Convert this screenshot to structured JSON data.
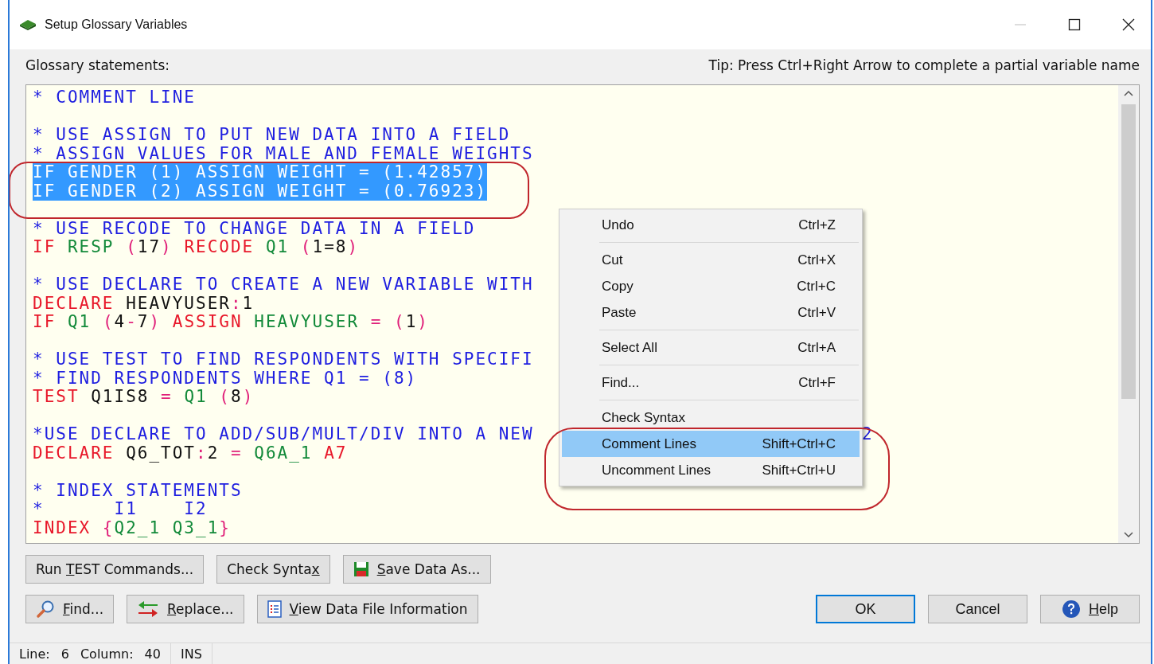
{
  "window": {
    "title": "Setup Glossary Variables"
  },
  "editor_label": "Glossary statements:",
  "tip": "Tip: Press Ctrl+Right Arrow to complete a partial variable name",
  "editor": {
    "lines": [
      {
        "selected": false,
        "tokens": [
          {
            "kind": "comment",
            "text": "* COMMENT LINE"
          }
        ]
      },
      {
        "kind": "blank"
      },
      {
        "selected": false,
        "tokens": [
          {
            "kind": "comment",
            "text": "* USE ASSIGN TO PUT NEW DATA INTO A FIELD"
          }
        ]
      },
      {
        "selected": false,
        "tokens": [
          {
            "kind": "comment",
            "text": "* ASSIGN VALUES FOR MALE AND FEMALE WEIGHTS"
          }
        ]
      },
      {
        "selected": true,
        "tokens": [
          {
            "kind": "plain",
            "text": "IF GENDER (1) ASSIGN WEIGHT = (1.42857)"
          }
        ]
      },
      {
        "selected": true,
        "tokens": [
          {
            "kind": "plain",
            "text": "IF GENDER (2) ASSIGN WEIGHT = (0.76923)"
          }
        ]
      },
      {
        "kind": "blank"
      },
      {
        "selected": false,
        "tokens": [
          {
            "kind": "comment",
            "text": "* USE RECODE TO CHANGE DATA IN A FIELD"
          }
        ]
      },
      {
        "selected": false,
        "tokens": [
          {
            "kind": "keyword",
            "text": "IF"
          },
          {
            "kind": "field",
            "text": " RESP"
          },
          {
            "kind": "symbol",
            "text": " ("
          },
          {
            "kind": "plain",
            "text": "17"
          },
          {
            "kind": "symbol",
            "text": ")"
          },
          {
            "kind": "keyword",
            "text": " RECODE"
          },
          {
            "kind": "field",
            "text": " Q1"
          },
          {
            "kind": "symbol",
            "text": " ("
          },
          {
            "kind": "plain",
            "text": "1=8"
          },
          {
            "kind": "symbol",
            "text": ")"
          }
        ]
      },
      {
        "kind": "blank"
      },
      {
        "selected": false,
        "tokens": [
          {
            "kind": "comment",
            "text": "* USE DECLARE TO CREATE A NEW VARIABLE WITH"
          }
        ]
      },
      {
        "selected": false,
        "tokens": [
          {
            "kind": "keyword",
            "text": "DECLARE"
          },
          {
            "kind": "plain",
            "text": " HEAVYUSER"
          },
          {
            "kind": "symbol",
            "text": ":"
          },
          {
            "kind": "plain",
            "text": "1"
          }
        ]
      },
      {
        "selected": false,
        "tokens": [
          {
            "kind": "keyword",
            "text": "IF"
          },
          {
            "kind": "field",
            "text": " Q1"
          },
          {
            "kind": "symbol",
            "text": " ("
          },
          {
            "kind": "plain",
            "text": "4"
          },
          {
            "kind": "symbol",
            "text": "-"
          },
          {
            "kind": "plain",
            "text": "7"
          },
          {
            "kind": "symbol",
            "text": ")"
          },
          {
            "kind": "keyword",
            "text": " ASSIGN"
          },
          {
            "kind": "field",
            "text": " HEAVYUSER"
          },
          {
            "kind": "symbol",
            "text": " = ("
          },
          {
            "kind": "plain",
            "text": "1"
          },
          {
            "kind": "symbol",
            "text": ")"
          }
        ]
      },
      {
        "kind": "blank"
      },
      {
        "selected": false,
        "tokens": [
          {
            "kind": "comment",
            "text": "* USE TEST TO FIND RESPONDENTS WITH SPECIFI"
          }
        ]
      },
      {
        "selected": false,
        "tokens": [
          {
            "kind": "comment",
            "text": "* FIND RESPONDENTS WHERE Q1 = (8)"
          }
        ]
      },
      {
        "selected": false,
        "tokens": [
          {
            "kind": "keyword",
            "text": "TEST"
          },
          {
            "kind": "plain",
            "text": " Q1IS8"
          },
          {
            "kind": "symbol",
            "text": " ="
          },
          {
            "kind": "field",
            "text": " Q1"
          },
          {
            "kind": "symbol",
            "text": " ("
          },
          {
            "kind": "plain",
            "text": "8"
          },
          {
            "kind": "symbol",
            "text": ")"
          }
        ]
      },
      {
        "kind": "blank"
      },
      {
        "selected": false,
        "tokens": [
          {
            "kind": "comment",
            "text": "*USE DECLARE TO ADD/SUB/MULT/DIV INTO A NEW"
          }
        ],
        "tail": "2"
      },
      {
        "selected": false,
        "tokens": [
          {
            "kind": "keyword",
            "text": "DECLARE"
          },
          {
            "kind": "plain",
            "text": " Q6_TOT"
          },
          {
            "kind": "symbol",
            "text": ":"
          },
          {
            "kind": "plain",
            "text": "2"
          },
          {
            "kind": "symbol",
            "text": " ="
          },
          {
            "kind": "field",
            "text": " Q6A_1"
          },
          {
            "kind": "keyword",
            "text": " A7"
          }
        ]
      },
      {
        "kind": "blank"
      },
      {
        "selected": false,
        "tokens": [
          {
            "kind": "comment",
            "text": "* INDEX STATEMENTS"
          }
        ]
      },
      {
        "selected": false,
        "tokens": [
          {
            "kind": "comment",
            "text": "*      I1    I2"
          }
        ]
      },
      {
        "selected": false,
        "tokens": [
          {
            "kind": "keyword",
            "text": "INDEX"
          },
          {
            "kind": "symbol",
            "text": " {"
          },
          {
            "kind": "field",
            "text": "Q2_1 Q3_1"
          },
          {
            "kind": "symbol",
            "text": "}"
          }
        ]
      }
    ]
  },
  "context_menu": {
    "items": [
      {
        "kind": "item",
        "label": "Undo",
        "shortcut": "Ctrl+Z",
        "selected": false
      },
      {
        "kind": "separator"
      },
      {
        "kind": "item",
        "label": "Cut",
        "shortcut": "Ctrl+X",
        "selected": false
      },
      {
        "kind": "item",
        "label": "Copy",
        "shortcut": "Ctrl+C",
        "selected": false
      },
      {
        "kind": "item",
        "label": "Paste",
        "shortcut": "Ctrl+V",
        "selected": false
      },
      {
        "kind": "separator"
      },
      {
        "kind": "item",
        "label": "Select All",
        "shortcut": "Ctrl+A",
        "selected": false
      },
      {
        "kind": "separator"
      },
      {
        "kind": "item",
        "label": "Find...",
        "shortcut": "Ctrl+F",
        "selected": false
      },
      {
        "kind": "separator"
      },
      {
        "kind": "item",
        "label": "Check Syntax",
        "selected": false
      },
      {
        "kind": "item",
        "label": "Comment Lines",
        "shortcut": "Shift+Ctrl+C",
        "selected": true
      },
      {
        "kind": "item",
        "label": "Uncomment Lines",
        "shortcut": "Shift+Ctrl+U",
        "selected": false
      }
    ]
  },
  "buttons_row_1": [
    {
      "kind": "text",
      "pre": "Run ",
      "key": "T",
      "post": "EST Commands..."
    },
    {
      "kind": "text",
      "pre": "Check Synta",
      "key": "x"
    },
    {
      "kind": "save",
      "key": "S",
      "post": "ave Data As..."
    }
  ],
  "buttons_row_2": [
    {
      "kind": "find",
      "key": "F",
      "post": "ind..."
    },
    {
      "kind": "replace",
      "key": "R",
      "post": "eplace..."
    },
    {
      "kind": "info",
      "key": "V",
      "post": "iew Data File Information"
    }
  ],
  "dialog_buttons": [
    {
      "kind": "text",
      "pre": "OK",
      "focused": true
    },
    {
      "kind": "text",
      "pre": "Cancel",
      "focused": false
    },
    {
      "kind": "help",
      "key": "H",
      "post": "elp",
      "focused": false
    }
  ],
  "status_bar": {
    "line_label": "Line:",
    "line": "6",
    "column_label": "Column:",
    "column": "40",
    "mode": "INS"
  }
}
